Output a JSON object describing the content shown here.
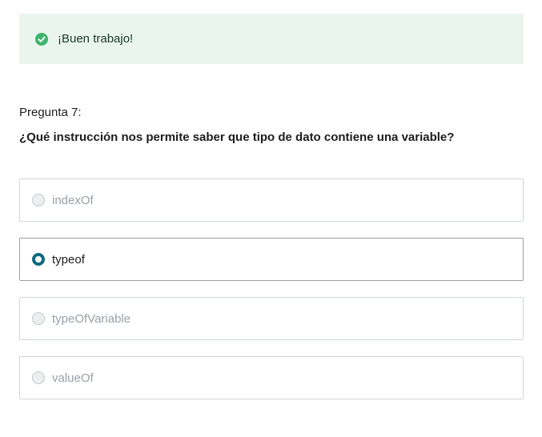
{
  "alert": {
    "message": "¡Buen trabajo!",
    "icon": "check-circle-icon",
    "color": "#3db56a"
  },
  "question": {
    "number": "Pregunta 7:",
    "text": "¿Qué instrucción nos permite saber que tipo de dato contiene una variable?"
  },
  "options": [
    {
      "label": "indexOf",
      "selected": false
    },
    {
      "label": "typeof",
      "selected": true
    },
    {
      "label": "typeOfVariable",
      "selected": false
    },
    {
      "label": "valueOf",
      "selected": false
    }
  ],
  "colors": {
    "accent": "#0f6a80",
    "success_bg": "#e9f5ee"
  }
}
